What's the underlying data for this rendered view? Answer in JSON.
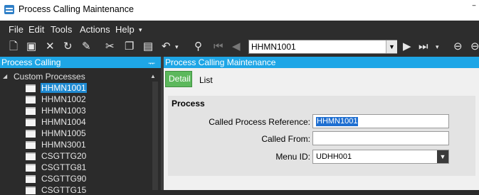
{
  "window": {
    "title": "Process Calling Maintenance",
    "minimize_glyph": "‾"
  },
  "menu": [
    {
      "label": "File"
    },
    {
      "label": "Edit"
    },
    {
      "label": "Tools"
    },
    {
      "label": "Actions"
    },
    {
      "label": "Help"
    },
    {
      "label": "▾"
    }
  ],
  "toolbar": {
    "icons": [
      "new-icon",
      "save-icon",
      "delete-icon",
      "refresh-icon",
      "clear-icon",
      "cut-icon",
      "copy-icon",
      "paste-icon",
      "undo-icon",
      "binoculars-icon",
      "first-record-icon",
      "previous-record-icon"
    ],
    "nav_value": "HHMN1001",
    "nav_icons": [
      "next-record-icon",
      "last-record-icon",
      "back-icon",
      "forward-icon"
    ]
  },
  "left_panel": {
    "title": "Process Calling",
    "pin_glyph": "ᅲ",
    "tree": {
      "root_label": "Custom Processes",
      "items": [
        {
          "label": "HHMN1001"
        },
        {
          "label": "HHMN1002"
        },
        {
          "label": "HHMN1003"
        },
        {
          "label": "HHMN1004"
        },
        {
          "label": "HHMN1005"
        },
        {
          "label": "HHMN3001"
        },
        {
          "label": "CSGTTG20"
        },
        {
          "label": "CSGTTG81"
        },
        {
          "label": "CSGTTG90"
        },
        {
          "label": "CSGTTG15"
        }
      ]
    }
  },
  "right_panel": {
    "title": "Process Calling Maintenance",
    "tabs": [
      {
        "label": "Detail"
      },
      {
        "label": "List"
      }
    ],
    "group_title": "Process",
    "fields": {
      "called_process_reference": {
        "label": "Called Process Reference:",
        "value": "HHMN1001"
      },
      "called_from": {
        "label": "Called From:",
        "value": ""
      },
      "menu_id": {
        "label": "Menu ID:",
        "value": "UDHH001"
      }
    }
  },
  "colors": {
    "accent": "#1ea6e6",
    "detail_tab": "#5cb85c",
    "selection": "#1f8ad1",
    "chrome": "#2d2d2d"
  }
}
